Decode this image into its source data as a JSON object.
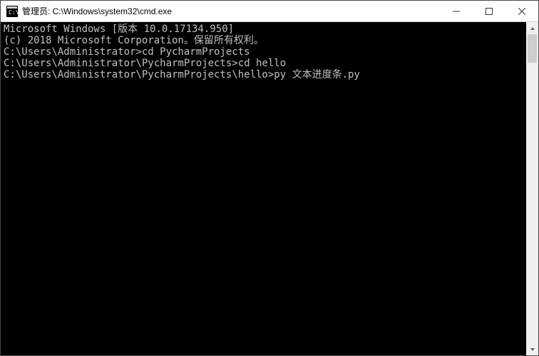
{
  "window": {
    "title": "管理员: C:\\Windows\\system32\\cmd.exe"
  },
  "terminal": {
    "lines": [
      "Microsoft Windows [版本 10.0.17134.950]",
      "(c) 2018 Microsoft Corporation。保留所有权利。",
      "",
      "C:\\Users\\Administrator>cd PycharmProjects",
      "",
      "C:\\Users\\Administrator\\PycharmProjects>cd hello",
      "",
      "C:\\Users\\Administrator\\PycharmProjects\\hello>py 文本进度条.py"
    ]
  }
}
